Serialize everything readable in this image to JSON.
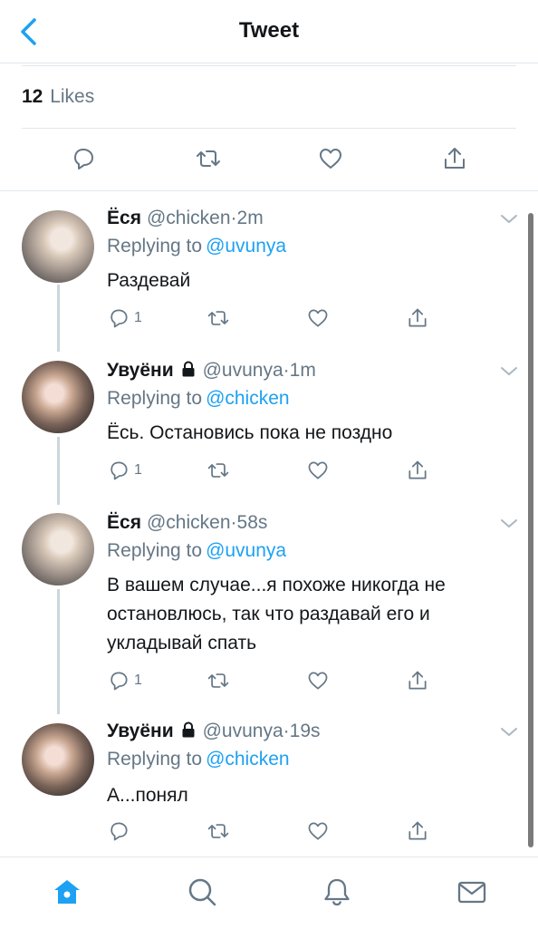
{
  "header": {
    "title": "Tweet",
    "back_icon": "chevron-left-icon"
  },
  "likes": {
    "count": "12",
    "label": "Likes"
  },
  "main_actions": [
    "reply-icon",
    "retweet-icon",
    "like-icon",
    "share-icon"
  ],
  "colors": {
    "accent": "#1da1f2",
    "muted": "#657786",
    "text": "#14171a",
    "divider": "#e1e8ed"
  },
  "replies": [
    {
      "name": "Ёся",
      "handle": "@chicken",
      "time": "2m",
      "locked": false,
      "replying_label": "Replying to",
      "replying_to": "@uvunya",
      "text": "Раздевай",
      "reply_count": "1"
    },
    {
      "name": "Увуёни",
      "handle": "@uvunya",
      "time": "1m",
      "locked": true,
      "replying_label": "Replying to",
      "replying_to": "@chicken",
      "text": "Ёсь. Остановись пока не поздно",
      "reply_count": "1"
    },
    {
      "name": "Ёся",
      "handle": "@chicken",
      "time": "58s",
      "locked": false,
      "replying_label": "Replying to",
      "replying_to": "@uvunya",
      "text": "В вашем случае...я похоже никогда не остановлюсь, так что раздавай его и укладывай спать",
      "reply_count": "1"
    },
    {
      "name": "Увуёни",
      "handle": "@uvunya",
      "time": "19s",
      "locked": true,
      "replying_label": "Replying to",
      "replying_to": "@chicken",
      "text": "А...понял",
      "reply_count": ""
    }
  ],
  "tabbar": {
    "items": [
      {
        "name": "home",
        "icon": "home-icon",
        "active": true
      },
      {
        "name": "search",
        "icon": "search-icon",
        "active": false
      },
      {
        "name": "notifications",
        "icon": "bell-icon",
        "active": false
      },
      {
        "name": "messages",
        "icon": "mail-icon",
        "active": false
      }
    ]
  }
}
